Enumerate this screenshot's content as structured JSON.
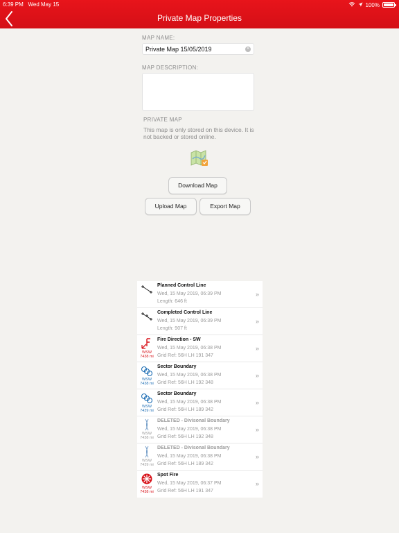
{
  "status_bar": {
    "time": "6:39 PM",
    "date": "Wed May 15",
    "battery": "100%"
  },
  "header": {
    "title": "Private Map Properties"
  },
  "form": {
    "name_label": "MAP NAME:",
    "name_value": "Private Map 15/05/2019",
    "description_label": "MAP DESCRIPTION:",
    "description_value": ""
  },
  "private_section": {
    "label": "PRIVATE MAP",
    "description": "This map is only stored on this device. It is not backed or stored online."
  },
  "buttons": {
    "download": "Download Map",
    "upload": "Upload Map",
    "export": "Export Map"
  },
  "items": [
    {
      "icon": "planned-control-line-icon",
      "title": "Planned Control Line",
      "date": "Wed, 15 May 2019, 06:39 PM",
      "detail": "Length: 646 ft",
      "dir": "",
      "dist": "",
      "deleted": false,
      "color": "#222222"
    },
    {
      "icon": "completed-control-line-icon",
      "title": "Completed Control Line",
      "date": "Wed, 15 May 2019, 06:39 PM",
      "detail": "Length: 907 ft",
      "dir": "",
      "dist": "",
      "deleted": false,
      "color": "#222222"
    },
    {
      "icon": "fire-direction-icon",
      "title": "Fire Direction - SW",
      "date": "Wed, 15 May 2019, 06:38 PM",
      "detail": "Grid Ref:  56H LH 191 347",
      "dir": "WSW",
      "dist": "7438 mi",
      "deleted": false,
      "color": "#d8141b"
    },
    {
      "icon": "sector-boundary-icon",
      "title": "Sector Boundary",
      "date": "Wed, 15 May 2019, 06:38 PM",
      "detail": "Grid Ref:  56H LH 192 348",
      "dir": "WSW",
      "dist": "7438 mi",
      "deleted": false,
      "color": "#1f6fb5"
    },
    {
      "icon": "sector-boundary-icon",
      "title": "Sector Boundary",
      "date": "Wed, 15 May 2019, 06:38 PM",
      "detail": "Grid Ref:  56H LH 189 342",
      "dir": "WSW",
      "dist": "7439 mi",
      "deleted": false,
      "color": "#1f6fb5"
    },
    {
      "icon": "divisional-boundary-icon",
      "title": "DELETED - Divisonal Boundary",
      "date": "Wed, 15 May 2019, 06:38 PM",
      "detail": "Grid Ref:  56H LH 192 348",
      "dir": "WSW",
      "dist": "7438 mi",
      "deleted": true,
      "color": "#9a9a9a"
    },
    {
      "icon": "divisional-boundary-icon",
      "title": "DELETED - Divisonal Boundary",
      "date": "Wed, 15 May 2019, 06:38 PM",
      "detail": "Grid Ref:  56H LH 189 342",
      "dir": "WSW",
      "dist": "7439 mi",
      "deleted": true,
      "color": "#9a9a9a"
    },
    {
      "icon": "spot-fire-icon",
      "title": "Spot Fire",
      "date": "Wed, 15 May 2019, 06:37 PM",
      "detail": "Grid Ref:  56H LH 191 347",
      "dir": "WSW",
      "dist": "7438 mi",
      "deleted": false,
      "color": "#d8141b"
    }
  ],
  "colors": {
    "header": "#d40f16",
    "background": "#f3f2ef",
    "accent_red": "#d8141b",
    "accent_blue": "#1f6fb5"
  }
}
